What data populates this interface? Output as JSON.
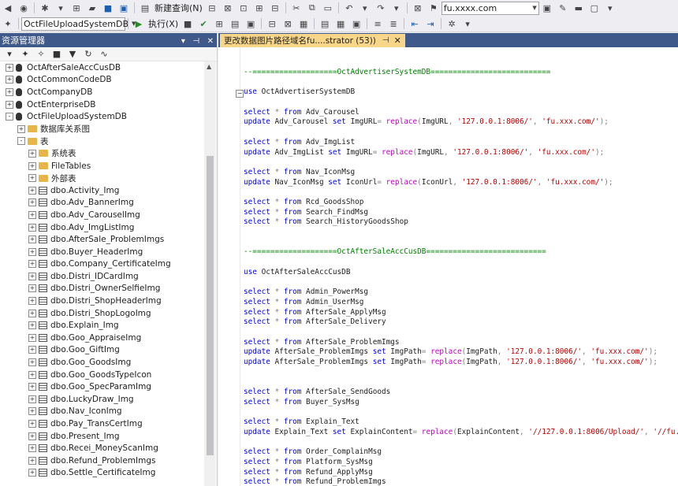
{
  "toolbar1": {
    "new_query_label": "新建查询(N)",
    "url_combo_value": "fu.xxxx.com"
  },
  "toolbar2": {
    "database_combo_value": "OctFileUploadSystemDB",
    "execute_label": "执行(X)"
  },
  "explorer": {
    "title": "资源管理器",
    "nodes": [
      {
        "label": "OctAfterSaleAccCusDB",
        "type": "db",
        "level": 0,
        "expander": "+"
      },
      {
        "label": "OctCommonCodeDB",
        "type": "db",
        "level": 0,
        "expander": "+"
      },
      {
        "label": "OctCompanyDB",
        "type": "db",
        "level": 0,
        "expander": "+"
      },
      {
        "label": "OctEnterpriseDB",
        "type": "db",
        "level": 0,
        "expander": "+"
      },
      {
        "label": "OctFileUploadSystemDB",
        "type": "db",
        "level": 0,
        "expander": "-"
      },
      {
        "label": "数据库关系图",
        "type": "folder",
        "level": 1,
        "expander": "+"
      },
      {
        "label": "表",
        "type": "folder",
        "level": 1,
        "expander": "-"
      },
      {
        "label": "系统表",
        "type": "folder",
        "level": 2,
        "expander": "+"
      },
      {
        "label": "FileTables",
        "type": "folder",
        "level": 2,
        "expander": "+"
      },
      {
        "label": "外部表",
        "type": "folder",
        "level": 2,
        "expander": "+"
      },
      {
        "label": "dbo.Activity_Img",
        "type": "table",
        "level": 2,
        "expander": "+"
      },
      {
        "label": "dbo.Adv_BannerImg",
        "type": "table",
        "level": 2,
        "expander": "+"
      },
      {
        "label": "dbo.Adv_CarouselImg",
        "type": "table",
        "level": 2,
        "expander": "+"
      },
      {
        "label": "dbo.Adv_ImgListImg",
        "type": "table",
        "level": 2,
        "expander": "+"
      },
      {
        "label": "dbo.AfterSale_ProblemImgs",
        "type": "table",
        "level": 2,
        "expander": "+"
      },
      {
        "label": "dbo.Buyer_HeaderImg",
        "type": "table",
        "level": 2,
        "expander": "+"
      },
      {
        "label": "dbo.Company_CertificateImg",
        "type": "table",
        "level": 2,
        "expander": "+"
      },
      {
        "label": "dbo.Distri_IDCardImg",
        "type": "table",
        "level": 2,
        "expander": "+"
      },
      {
        "label": "dbo.Distri_OwnerSelfieImg",
        "type": "table",
        "level": 2,
        "expander": "+"
      },
      {
        "label": "dbo.Distri_ShopHeaderImg",
        "type": "table",
        "level": 2,
        "expander": "+"
      },
      {
        "label": "dbo.Distri_ShopLogoImg",
        "type": "table",
        "level": 2,
        "expander": "+"
      },
      {
        "label": "dbo.Explain_Img",
        "type": "table",
        "level": 2,
        "expander": "+"
      },
      {
        "label": "dbo.Goo_AppraiseImg",
        "type": "table",
        "level": 2,
        "expander": "+"
      },
      {
        "label": "dbo.Goo_GiftImg",
        "type": "table",
        "level": 2,
        "expander": "+"
      },
      {
        "label": "dbo.Goo_GoodsImg",
        "type": "table",
        "level": 2,
        "expander": "+"
      },
      {
        "label": "dbo.Goo_GoodsTypeIcon",
        "type": "table",
        "level": 2,
        "expander": "+"
      },
      {
        "label": "dbo.Goo_SpecParamImg",
        "type": "table",
        "level": 2,
        "expander": "+"
      },
      {
        "label": "dbo.LuckyDraw_Img",
        "type": "table",
        "level": 2,
        "expander": "+"
      },
      {
        "label": "dbo.Nav_IconImg",
        "type": "table",
        "level": 2,
        "expander": "+"
      },
      {
        "label": "dbo.Pay_TransCertImg",
        "type": "table",
        "level": 2,
        "expander": "+"
      },
      {
        "label": "dbo.Present_Img",
        "type": "table",
        "level": 2,
        "expander": "+"
      },
      {
        "label": "dbo.Recei_MoneyScanImg",
        "type": "table",
        "level": 2,
        "expander": "+"
      },
      {
        "label": "dbo.Refund_ProblemImgs",
        "type": "table",
        "level": 2,
        "expander": "+"
      },
      {
        "label": "dbo.Settle_CertificateImg",
        "type": "table",
        "level": 2,
        "expander": "+"
      }
    ]
  },
  "editor": {
    "tab_title": "更改数据图片路径域名fu....strator (53))",
    "lines": [
      [
        {
          "t": "--===================OctAdvertiserSystemDB===========================",
          "c": "cmt"
        }
      ],
      [],
      [
        {
          "t": "use ",
          "c": "kw"
        },
        {
          "t": "OctAdvertiserSystemDB",
          "c": "plain"
        }
      ],
      [],
      [
        {
          "t": "select ",
          "c": "kw"
        },
        {
          "t": "* ",
          "c": "gray"
        },
        {
          "t": "from ",
          "c": "kw"
        },
        {
          "t": "Adv_Carousel",
          "c": "plain"
        }
      ],
      [
        {
          "t": "update ",
          "c": "kw"
        },
        {
          "t": "Adv_Carousel ",
          "c": "plain"
        },
        {
          "t": "set ",
          "c": "kw"
        },
        {
          "t": "ImgURL",
          "c": "plain"
        },
        {
          "t": "= ",
          "c": "gray"
        },
        {
          "t": "replace",
          "c": "fn"
        },
        {
          "t": "(",
          "c": "gray"
        },
        {
          "t": "ImgURL",
          "c": "plain"
        },
        {
          "t": ", ",
          "c": "gray"
        },
        {
          "t": "'127.0.0.1:8006/'",
          "c": "str"
        },
        {
          "t": ", ",
          "c": "gray"
        },
        {
          "t": "'fu.xxx.com/'",
          "c": "str"
        },
        {
          "t": ");",
          "c": "gray"
        }
      ],
      [],
      [
        {
          "t": "select ",
          "c": "kw"
        },
        {
          "t": "* ",
          "c": "gray"
        },
        {
          "t": "from ",
          "c": "kw"
        },
        {
          "t": "Adv_ImgList",
          "c": "plain"
        }
      ],
      [
        {
          "t": "update ",
          "c": "kw"
        },
        {
          "t": "Adv_ImgList ",
          "c": "plain"
        },
        {
          "t": "set ",
          "c": "kw"
        },
        {
          "t": "ImgURL",
          "c": "plain"
        },
        {
          "t": "= ",
          "c": "gray"
        },
        {
          "t": "replace",
          "c": "fn"
        },
        {
          "t": "(",
          "c": "gray"
        },
        {
          "t": "ImgURL",
          "c": "plain"
        },
        {
          "t": ", ",
          "c": "gray"
        },
        {
          "t": "'127.0.0.1:8006/'",
          "c": "str"
        },
        {
          "t": ", ",
          "c": "gray"
        },
        {
          "t": "'fu.xxx.com/'",
          "c": "str"
        },
        {
          "t": ");",
          "c": "gray"
        }
      ],
      [],
      [
        {
          "t": "select ",
          "c": "kw"
        },
        {
          "t": "* ",
          "c": "gray"
        },
        {
          "t": "from ",
          "c": "kw"
        },
        {
          "t": "Nav_IconMsg",
          "c": "plain"
        }
      ],
      [
        {
          "t": "update ",
          "c": "kw"
        },
        {
          "t": "Nav_IconMsg ",
          "c": "plain"
        },
        {
          "t": "set ",
          "c": "kw"
        },
        {
          "t": "IconUrl",
          "c": "plain"
        },
        {
          "t": "= ",
          "c": "gray"
        },
        {
          "t": "replace",
          "c": "fn"
        },
        {
          "t": "(",
          "c": "gray"
        },
        {
          "t": "IconUrl",
          "c": "plain"
        },
        {
          "t": ", ",
          "c": "gray"
        },
        {
          "t": "'127.0.0.1:8006/'",
          "c": "str"
        },
        {
          "t": ", ",
          "c": "gray"
        },
        {
          "t": "'fu.xxx.com/'",
          "c": "str"
        },
        {
          "t": ");",
          "c": "gray"
        }
      ],
      [],
      [
        {
          "t": "select ",
          "c": "kw"
        },
        {
          "t": "* ",
          "c": "gray"
        },
        {
          "t": "from ",
          "c": "kw"
        },
        {
          "t": "Rcd_GoodsShop",
          "c": "plain"
        }
      ],
      [
        {
          "t": "select ",
          "c": "kw"
        },
        {
          "t": "* ",
          "c": "gray"
        },
        {
          "t": "from ",
          "c": "kw"
        },
        {
          "t": "Search_FindMsg",
          "c": "plain"
        }
      ],
      [
        {
          "t": "select ",
          "c": "kw"
        },
        {
          "t": "* ",
          "c": "gray"
        },
        {
          "t": "from ",
          "c": "kw"
        },
        {
          "t": "Search_HistoryGoodsShop",
          "c": "plain"
        }
      ],
      [],
      [],
      [
        {
          "t": "--===================OctAfterSaleAccCusDB===========================",
          "c": "cmt"
        }
      ],
      [],
      [
        {
          "t": "use ",
          "c": "kw"
        },
        {
          "t": "OctAfterSaleAccCusDB",
          "c": "plain"
        }
      ],
      [],
      [
        {
          "t": "select ",
          "c": "kw"
        },
        {
          "t": "* ",
          "c": "gray"
        },
        {
          "t": "from ",
          "c": "kw"
        },
        {
          "t": "Admin_PowerMsg",
          "c": "plain"
        }
      ],
      [
        {
          "t": "select ",
          "c": "kw"
        },
        {
          "t": "* ",
          "c": "gray"
        },
        {
          "t": "from ",
          "c": "kw"
        },
        {
          "t": "Admin_UserMsg",
          "c": "plain"
        }
      ],
      [
        {
          "t": "select ",
          "c": "kw"
        },
        {
          "t": "* ",
          "c": "gray"
        },
        {
          "t": "from ",
          "c": "kw"
        },
        {
          "t": "AfterSale_ApplyMsg",
          "c": "plain"
        }
      ],
      [
        {
          "t": "select ",
          "c": "kw"
        },
        {
          "t": "* ",
          "c": "gray"
        },
        {
          "t": "from ",
          "c": "kw"
        },
        {
          "t": "AfterSale_Delivery",
          "c": "plain"
        }
      ],
      [],
      [
        {
          "t": "select ",
          "c": "kw"
        },
        {
          "t": "* ",
          "c": "gray"
        },
        {
          "t": "from ",
          "c": "kw"
        },
        {
          "t": "AfterSale_ProblemImgs",
          "c": "plain"
        }
      ],
      [
        {
          "t": "update ",
          "c": "kw"
        },
        {
          "t": "AfterSale_ProblemImgs ",
          "c": "plain"
        },
        {
          "t": "set ",
          "c": "kw"
        },
        {
          "t": "ImgPath",
          "c": "plain"
        },
        {
          "t": "= ",
          "c": "gray"
        },
        {
          "t": "replace",
          "c": "fn"
        },
        {
          "t": "(",
          "c": "gray"
        },
        {
          "t": "ImgPath",
          "c": "plain"
        },
        {
          "t": ", ",
          "c": "gray"
        },
        {
          "t": "'127.0.0.1:8006/'",
          "c": "str"
        },
        {
          "t": ", ",
          "c": "gray"
        },
        {
          "t": "'fu.xxx.com/'",
          "c": "str"
        },
        {
          "t": ");",
          "c": "gray"
        }
      ],
      [
        {
          "t": "update ",
          "c": "kw"
        },
        {
          "t": "AfterSale_ProblemImgs ",
          "c": "plain"
        },
        {
          "t": "set ",
          "c": "kw"
        },
        {
          "t": "ImgPath",
          "c": "plain"
        },
        {
          "t": "= ",
          "c": "gray"
        },
        {
          "t": "replace",
          "c": "fn"
        },
        {
          "t": "(",
          "c": "gray"
        },
        {
          "t": "ImgPath",
          "c": "plain"
        },
        {
          "t": ", ",
          "c": "gray"
        },
        {
          "t": "'127.0.0.1:8006/'",
          "c": "str"
        },
        {
          "t": ", ",
          "c": "gray"
        },
        {
          "t": "'fu.xxx.com/'",
          "c": "str"
        },
        {
          "t": ");",
          "c": "gray"
        }
      ],
      [],
      [],
      [
        {
          "t": "select ",
          "c": "kw"
        },
        {
          "t": "* ",
          "c": "gray"
        },
        {
          "t": "from ",
          "c": "kw"
        },
        {
          "t": "AfterSale_SendGoods",
          "c": "plain"
        }
      ],
      [
        {
          "t": "select ",
          "c": "kw"
        },
        {
          "t": "* ",
          "c": "gray"
        },
        {
          "t": "from ",
          "c": "kw"
        },
        {
          "t": "Buyer_SysMsg",
          "c": "plain"
        }
      ],
      [],
      [
        {
          "t": "select ",
          "c": "kw"
        },
        {
          "t": "* ",
          "c": "gray"
        },
        {
          "t": "from ",
          "c": "kw"
        },
        {
          "t": "Explain_Text",
          "c": "plain"
        }
      ],
      [
        {
          "t": "update ",
          "c": "kw"
        },
        {
          "t": "Explain_Text ",
          "c": "plain"
        },
        {
          "t": "set ",
          "c": "kw"
        },
        {
          "t": "ExplainContent",
          "c": "plain"
        },
        {
          "t": "= ",
          "c": "gray"
        },
        {
          "t": "replace",
          "c": "fn"
        },
        {
          "t": "(",
          "c": "gray"
        },
        {
          "t": "ExplainContent",
          "c": "plain"
        },
        {
          "t": ", ",
          "c": "gray"
        },
        {
          "t": "'//127.0.0.1:8006/Upload/'",
          "c": "str"
        },
        {
          "t": ", ",
          "c": "gray"
        },
        {
          "t": "'//fu.xx",
          "c": "str"
        }
      ],
      [],
      [
        {
          "t": "select ",
          "c": "kw"
        },
        {
          "t": "* ",
          "c": "gray"
        },
        {
          "t": "from ",
          "c": "kw"
        },
        {
          "t": "Order_ComplainMsg",
          "c": "plain"
        }
      ],
      [
        {
          "t": "select ",
          "c": "kw"
        },
        {
          "t": "* ",
          "c": "gray"
        },
        {
          "t": "from ",
          "c": "kw"
        },
        {
          "t": "Platform_SysMsg",
          "c": "plain"
        }
      ],
      [
        {
          "t": "select ",
          "c": "kw"
        },
        {
          "t": "* ",
          "c": "gray"
        },
        {
          "t": "from ",
          "c": "kw"
        },
        {
          "t": "Refund_ApplyMsg",
          "c": "plain"
        }
      ],
      [
        {
          "t": "select ",
          "c": "kw"
        },
        {
          "t": "* ",
          "c": "gray"
        },
        {
          "t": "from ",
          "c": "kw"
        },
        {
          "t": "Refund_ProblemImgs",
          "c": "plain"
        }
      ]
    ]
  }
}
